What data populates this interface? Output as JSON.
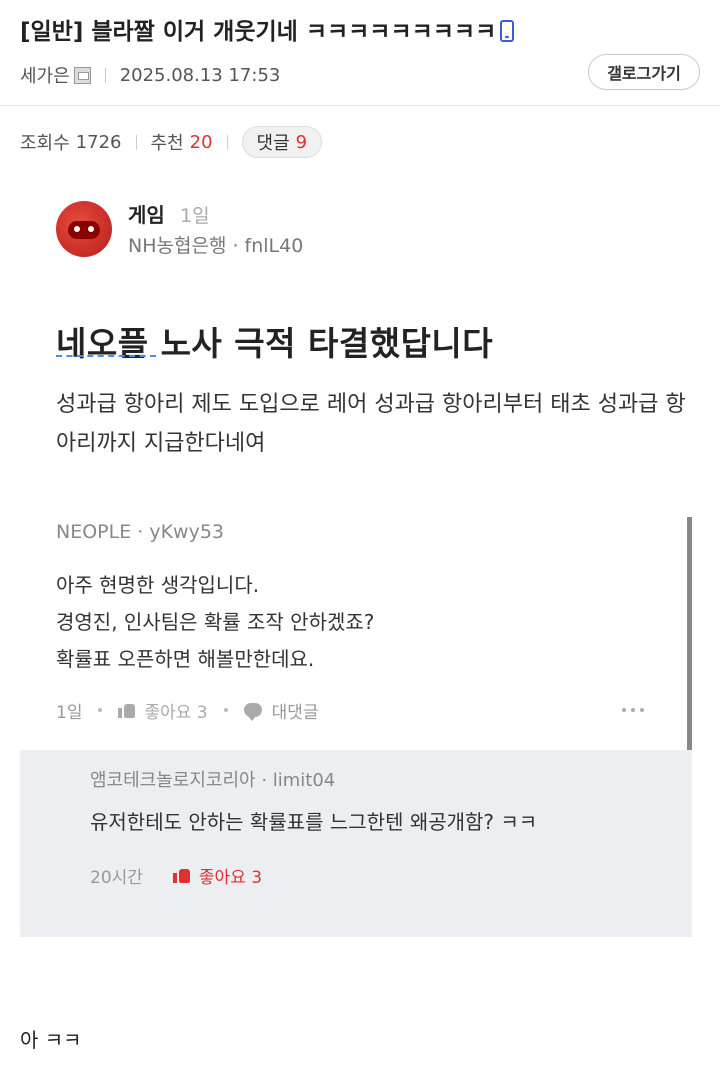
{
  "post": {
    "title": "[일반] 블라짤 이거 개웃기네 ㅋㅋㅋㅋㅋㅋㅋㅋㅋ",
    "author": "세가은",
    "date": "2025.08.13 17:53",
    "gallery_button": "갤로그가기",
    "views_label": "조회수",
    "views": "1726",
    "recommend_label": "추천",
    "recommend": "20",
    "comments_label": "댓글",
    "comments": "9",
    "body_text": "아 ㅋㅋ"
  },
  "screenshot": {
    "board_name": "게임",
    "board_time": "1일",
    "board_author": "NH농협은행 · fnlL40",
    "title": "네오플 노사 극적 타결했답니다",
    "body": "성과급 항아리 제도 도입으로 레어 성과급 항아리부터 태초 성과급 항아리까지 지급한다네여",
    "comment": {
      "author": "NEOPLE · yKwy53",
      "text": "아주 현명한 생각입니다.\n경영진, 인사팀은 확률 조작 안하겠죠?\n확률표 오픈하면 해볼만한데요.",
      "time": "1일",
      "like_label": "좋아요 3",
      "reply_label": "대댓글"
    },
    "reply": {
      "author": "앰코테크놀로지코리아 · limit04",
      "text": "유저한테도 안하는 확률표를 느그한텐 왜공개함? ㅋㅋ",
      "time": "20시간",
      "like_label": "좋아요 3"
    }
  },
  "colors": {
    "accent_red": "#d33333",
    "reply_bg": "#eceef2",
    "mobile_icon_blue": "#3b5bdb"
  }
}
